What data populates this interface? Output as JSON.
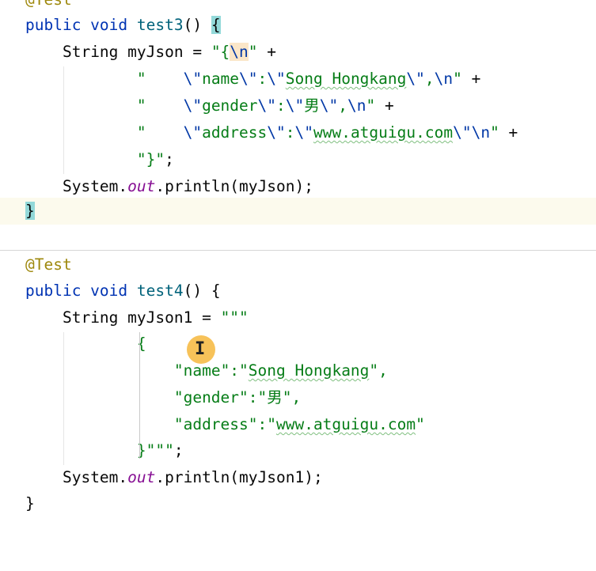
{
  "colors": {
    "keyword": "#0033b3",
    "method": "#00627a",
    "string": "#067d17",
    "escape": "#0037a6",
    "annotation": "#9e880d",
    "static_field": "#871094",
    "brace_match": "#93d9d9",
    "caret_line": "#fcfaed"
  },
  "method1": {
    "annotation_partial": "@Test",
    "sig_kw": "public void ",
    "name": "test3",
    "sig_rest": "() ",
    "open_brace": "{",
    "l1_indent": "    ",
    "l1_decl": "String myJson = ",
    "l1_q": "\"{",
    "l1_esc": "\\n",
    "l1_qend": "\"",
    "l1_plus": " +",
    "l2_indent": "            ",
    "l2_s1": "\"    ",
    "l2_e1": "\\\"",
    "l2_s2": "name",
    "l2_e2": "\\\"",
    "l2_s3": ":",
    "l2_e3": "\\\"",
    "l2_s4": "Song Hongkang",
    "l2_e4": "\\\"",
    "l2_s5": ",",
    "l2_e5": "\\n",
    "l2_s6": "\"",
    "l2_plus": " +",
    "l3_indent": "            ",
    "l3_s1": "\"    ",
    "l3_e1": "\\\"",
    "l3_s2": "gender",
    "l3_e2": "\\\"",
    "l3_s3": ":",
    "l3_e3": "\\\"",
    "l3_s4": "男",
    "l3_e4": "\\\"",
    "l3_s5": ",",
    "l3_e5": "\\n",
    "l3_s6": "\"",
    "l3_plus": " +",
    "l4_indent": "            ",
    "l4_s1": "\"    ",
    "l4_e1": "\\\"",
    "l4_s2": "address",
    "l4_e2": "\\\"",
    "l4_s3": ":",
    "l4_e3": "\\\"",
    "l4_s4": "www.atguigu.com",
    "l4_e4": "\\\"",
    "l4_e5": "\\n",
    "l4_s6": "\"",
    "l4_plus": " +",
    "l5_indent": "            ",
    "l5_str": "\"}\"",
    "l5_semi": ";",
    "l6_indent": "    ",
    "l6_a": "System.",
    "l6_out": "out",
    "l6_b": ".println(myJson);",
    "close_brace": "}"
  },
  "method2": {
    "annotation": "@Test",
    "sig_kw": "public void ",
    "name": "test4",
    "sig_rest": "() {",
    "l1_indent": "    ",
    "l1_decl": "String myJson1 = ",
    "l1_str": "\"\"\"",
    "l2_indent": "            ",
    "l2_str": "{",
    "l3_indent": "                ",
    "l3_q1": "\"",
    "l3_key": "name",
    "l3_q2": "\":\"",
    "l3_val": "Song Hongkang",
    "l3_q3": "\",",
    "l4_indent": "                ",
    "l4_q1": "\"gender\":\"",
    "l4_val": "男",
    "l4_q2": "\",",
    "l5_indent": "                ",
    "l5_q1": "\"address\":\"",
    "l5_val": "www.atguigu.com",
    "l5_q2": "\"",
    "l6_indent": "            ",
    "l6_str": "}\"\"\"",
    "l6_semi": ";",
    "l7_indent": "    ",
    "l7_a": "System.",
    "l7_out": "out",
    "l7_b": ".println(myJson1);",
    "close_brace": "}"
  },
  "mouse_cursor": "I"
}
